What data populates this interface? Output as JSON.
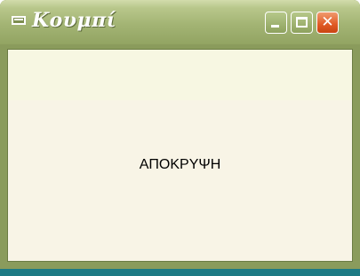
{
  "window": {
    "title": "Κουμπί",
    "system_icon": "window-icon",
    "controls": {
      "minimize_icon": "minimize-icon",
      "maximize_icon": "maximize-icon",
      "close_icon": "close-icon",
      "close_glyph": "✕"
    }
  },
  "content": {
    "label": "ΑΠΟΚΡΥΨΗ"
  },
  "colors": {
    "titlebar": "#a3b474",
    "close_button": "#e05a24",
    "client_background": "#f8f4e6",
    "taskbar_strip": "#1d7a84"
  }
}
